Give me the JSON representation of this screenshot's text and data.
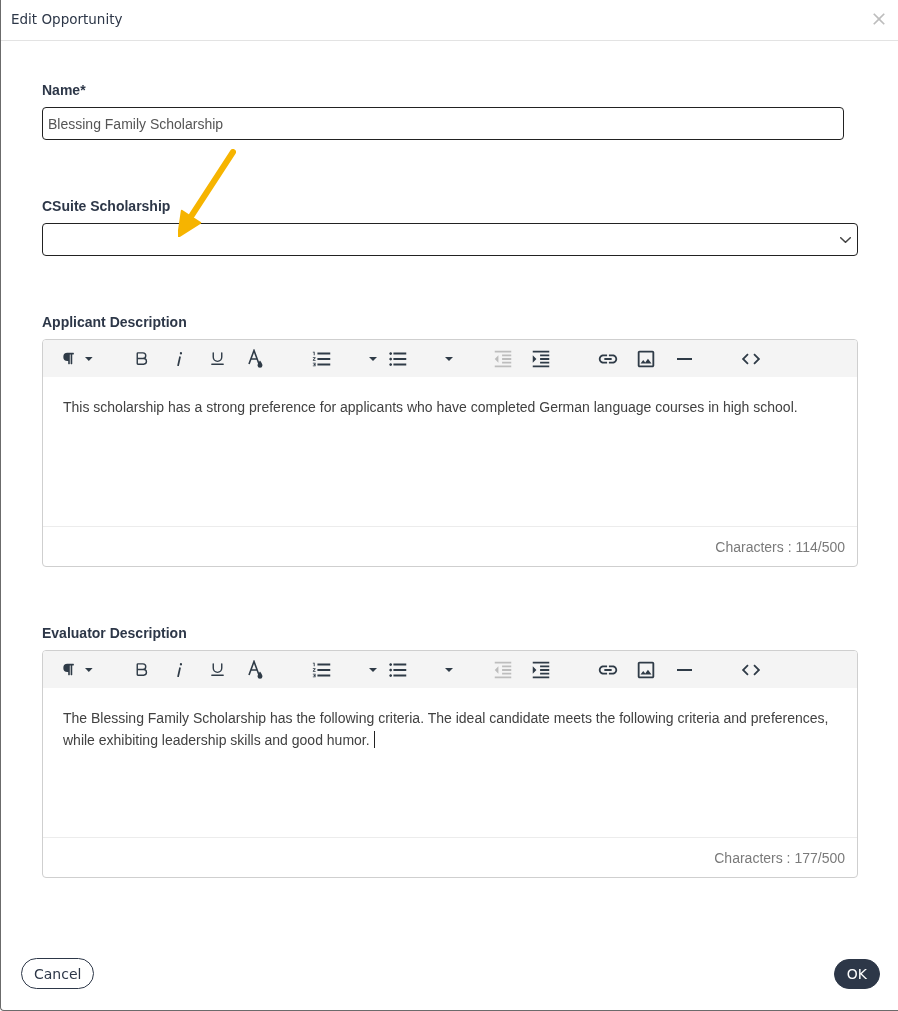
{
  "dialog": {
    "title": "Edit Opportunity"
  },
  "name_field": {
    "label": "Name*",
    "value": "Blessing Family Scholarship"
  },
  "csuite_scholarship": {
    "label": "CSuite Scholarship"
  },
  "editors": [
    {
      "label": "Applicant Description",
      "toolbar": [
        {
          "tools": [
            {
              "kind": "paragraph",
              "disabled": false
            }
          ]
        },
        {
          "tools": [
            {
              "kind": "bold",
              "disabled": false
            },
            {
              "kind": "italic",
              "disabled": false
            },
            {
              "kind": "underline",
              "disabled": false
            },
            {
              "kind": "textcolor",
              "disabled": false
            }
          ]
        },
        {
          "tools": [
            {
              "kind": "orderedlist",
              "disabled": false
            },
            {
              "kind": "listmenu",
              "disabled": false
            },
            {
              "kind": "bulletlist",
              "disabled": false
            },
            {
              "kind": "listmenu",
              "disabled": false
            }
          ]
        },
        {
          "tools": [
            {
              "kind": "outdent",
              "disabled": true
            },
            {
              "kind": "indent",
              "disabled": false
            }
          ]
        },
        {
          "tools": [
            {
              "kind": "link",
              "disabled": false
            },
            {
              "kind": "image",
              "disabled": false
            },
            {
              "kind": "hrule",
              "disabled": false
            }
          ]
        },
        {
          "tools": [
            {
              "kind": "codeview",
              "disabled": false
            }
          ]
        }
      ],
      "text": "This scholarship has a strong preference for applicants who have completed German language courses in high school.",
      "focused": false,
      "character_count": "Characters : 114/500"
    },
    {
      "label": "Evaluator Description",
      "toolbar": [
        {
          "tools": [
            {
              "kind": "paragraph",
              "disabled": false
            }
          ]
        },
        {
          "tools": [
            {
              "kind": "bold",
              "disabled": false
            },
            {
              "kind": "italic",
              "disabled": false
            },
            {
              "kind": "underline",
              "disabled": false
            },
            {
              "kind": "textcolor",
              "disabled": false
            }
          ]
        },
        {
          "tools": [
            {
              "kind": "orderedlist",
              "disabled": false
            },
            {
              "kind": "listmenu",
              "disabled": false
            },
            {
              "kind": "bulletlist",
              "disabled": false
            },
            {
              "kind": "listmenu",
              "disabled": false
            }
          ]
        },
        {
          "tools": [
            {
              "kind": "outdent",
              "disabled": true
            },
            {
              "kind": "indent",
              "disabled": false
            }
          ]
        },
        {
          "tools": [
            {
              "kind": "link",
              "disabled": false
            },
            {
              "kind": "image",
              "disabled": false
            },
            {
              "kind": "hrule",
              "disabled": false
            }
          ]
        },
        {
          "tools": [
            {
              "kind": "codeview",
              "disabled": false
            }
          ]
        }
      ],
      "text": "The Blessing Family Scholarship has the following criteria. The ideal candidate meets the following criteria and preferences, while exhibiting leadership skills and good humor.",
      "focused": true,
      "character_count": "Characters : 177/500"
    }
  ],
  "buttons": [
    {
      "label": "Cancel",
      "kind": "secondary"
    },
    {
      "label": "OK",
      "kind": "primary"
    }
  ]
}
